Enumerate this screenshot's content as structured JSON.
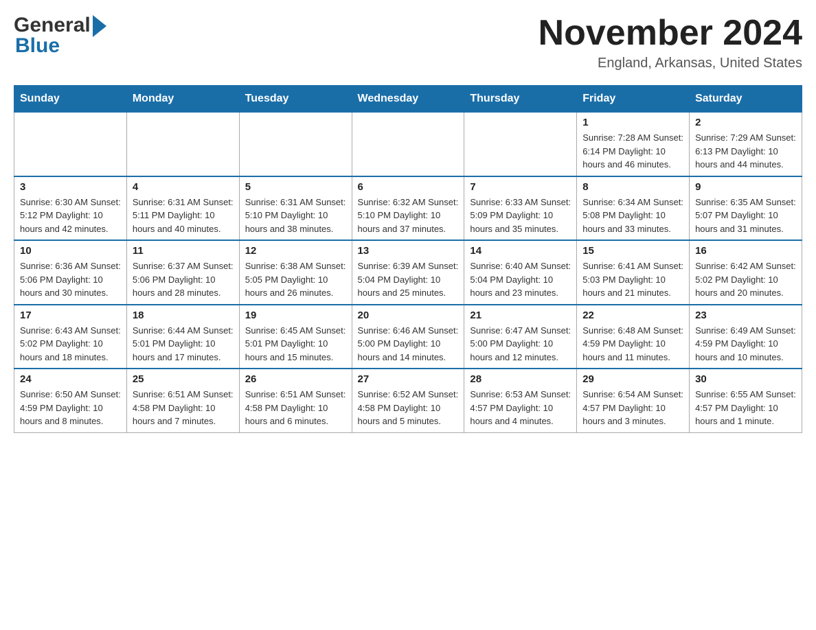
{
  "logo": {
    "general": "General",
    "blue": "Blue"
  },
  "header": {
    "month_title": "November 2024",
    "location": "England, Arkansas, United States"
  },
  "calendar": {
    "days_of_week": [
      "Sunday",
      "Monday",
      "Tuesday",
      "Wednesday",
      "Thursday",
      "Friday",
      "Saturday"
    ],
    "weeks": [
      {
        "days": [
          {
            "number": "",
            "info": ""
          },
          {
            "number": "",
            "info": ""
          },
          {
            "number": "",
            "info": ""
          },
          {
            "number": "",
            "info": ""
          },
          {
            "number": "",
            "info": ""
          },
          {
            "number": "1",
            "info": "Sunrise: 7:28 AM\nSunset: 6:14 PM\nDaylight: 10 hours and 46 minutes."
          },
          {
            "number": "2",
            "info": "Sunrise: 7:29 AM\nSunset: 6:13 PM\nDaylight: 10 hours and 44 minutes."
          }
        ]
      },
      {
        "days": [
          {
            "number": "3",
            "info": "Sunrise: 6:30 AM\nSunset: 5:12 PM\nDaylight: 10 hours and 42 minutes."
          },
          {
            "number": "4",
            "info": "Sunrise: 6:31 AM\nSunset: 5:11 PM\nDaylight: 10 hours and 40 minutes."
          },
          {
            "number": "5",
            "info": "Sunrise: 6:31 AM\nSunset: 5:10 PM\nDaylight: 10 hours and 38 minutes."
          },
          {
            "number": "6",
            "info": "Sunrise: 6:32 AM\nSunset: 5:10 PM\nDaylight: 10 hours and 37 minutes."
          },
          {
            "number": "7",
            "info": "Sunrise: 6:33 AM\nSunset: 5:09 PM\nDaylight: 10 hours and 35 minutes."
          },
          {
            "number": "8",
            "info": "Sunrise: 6:34 AM\nSunset: 5:08 PM\nDaylight: 10 hours and 33 minutes."
          },
          {
            "number": "9",
            "info": "Sunrise: 6:35 AM\nSunset: 5:07 PM\nDaylight: 10 hours and 31 minutes."
          }
        ]
      },
      {
        "days": [
          {
            "number": "10",
            "info": "Sunrise: 6:36 AM\nSunset: 5:06 PM\nDaylight: 10 hours and 30 minutes."
          },
          {
            "number": "11",
            "info": "Sunrise: 6:37 AM\nSunset: 5:06 PM\nDaylight: 10 hours and 28 minutes."
          },
          {
            "number": "12",
            "info": "Sunrise: 6:38 AM\nSunset: 5:05 PM\nDaylight: 10 hours and 26 minutes."
          },
          {
            "number": "13",
            "info": "Sunrise: 6:39 AM\nSunset: 5:04 PM\nDaylight: 10 hours and 25 minutes."
          },
          {
            "number": "14",
            "info": "Sunrise: 6:40 AM\nSunset: 5:04 PM\nDaylight: 10 hours and 23 minutes."
          },
          {
            "number": "15",
            "info": "Sunrise: 6:41 AM\nSunset: 5:03 PM\nDaylight: 10 hours and 21 minutes."
          },
          {
            "number": "16",
            "info": "Sunrise: 6:42 AM\nSunset: 5:02 PM\nDaylight: 10 hours and 20 minutes."
          }
        ]
      },
      {
        "days": [
          {
            "number": "17",
            "info": "Sunrise: 6:43 AM\nSunset: 5:02 PM\nDaylight: 10 hours and 18 minutes."
          },
          {
            "number": "18",
            "info": "Sunrise: 6:44 AM\nSunset: 5:01 PM\nDaylight: 10 hours and 17 minutes."
          },
          {
            "number": "19",
            "info": "Sunrise: 6:45 AM\nSunset: 5:01 PM\nDaylight: 10 hours and 15 minutes."
          },
          {
            "number": "20",
            "info": "Sunrise: 6:46 AM\nSunset: 5:00 PM\nDaylight: 10 hours and 14 minutes."
          },
          {
            "number": "21",
            "info": "Sunrise: 6:47 AM\nSunset: 5:00 PM\nDaylight: 10 hours and 12 minutes."
          },
          {
            "number": "22",
            "info": "Sunrise: 6:48 AM\nSunset: 4:59 PM\nDaylight: 10 hours and 11 minutes."
          },
          {
            "number": "23",
            "info": "Sunrise: 6:49 AM\nSunset: 4:59 PM\nDaylight: 10 hours and 10 minutes."
          }
        ]
      },
      {
        "days": [
          {
            "number": "24",
            "info": "Sunrise: 6:50 AM\nSunset: 4:59 PM\nDaylight: 10 hours and 8 minutes."
          },
          {
            "number": "25",
            "info": "Sunrise: 6:51 AM\nSunset: 4:58 PM\nDaylight: 10 hours and 7 minutes."
          },
          {
            "number": "26",
            "info": "Sunrise: 6:51 AM\nSunset: 4:58 PM\nDaylight: 10 hours and 6 minutes."
          },
          {
            "number": "27",
            "info": "Sunrise: 6:52 AM\nSunset: 4:58 PM\nDaylight: 10 hours and 5 minutes."
          },
          {
            "number": "28",
            "info": "Sunrise: 6:53 AM\nSunset: 4:57 PM\nDaylight: 10 hours and 4 minutes."
          },
          {
            "number": "29",
            "info": "Sunrise: 6:54 AM\nSunset: 4:57 PM\nDaylight: 10 hours and 3 minutes."
          },
          {
            "number": "30",
            "info": "Sunrise: 6:55 AM\nSunset: 4:57 PM\nDaylight: 10 hours and 1 minute."
          }
        ]
      }
    ]
  }
}
